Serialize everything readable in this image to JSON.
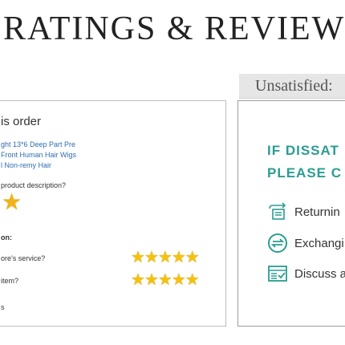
{
  "header": {
    "title": "RATINGS & REVIEWS"
  },
  "review_card": {
    "order_title": "is order",
    "product_name_lines": [
      "ght 13*6 Deep Part Pre",
      "Front Human Hair Wigs",
      "l Non-remy Hair"
    ],
    "question_description": "product description?",
    "description_rating": 1,
    "section_label": "on:",
    "question_service": "ore's service?",
    "service_rating": 5,
    "question_item": "item?",
    "item_rating": 5,
    "footer_text": "s"
  },
  "support_panel": {
    "banner": "Unsatisfied:",
    "heading_line1": "IF DISSAT",
    "heading_line2": "PLEASE C",
    "options": [
      {
        "icon": "return-package-icon",
        "label": "Returnin"
      },
      {
        "icon": "exchange-icon",
        "label": "Exchangi"
      },
      {
        "icon": "discuss-document-icon",
        "label": "Discuss a"
      }
    ],
    "accent_color": "#2a9d92",
    "star_color": "#f4c20d"
  }
}
